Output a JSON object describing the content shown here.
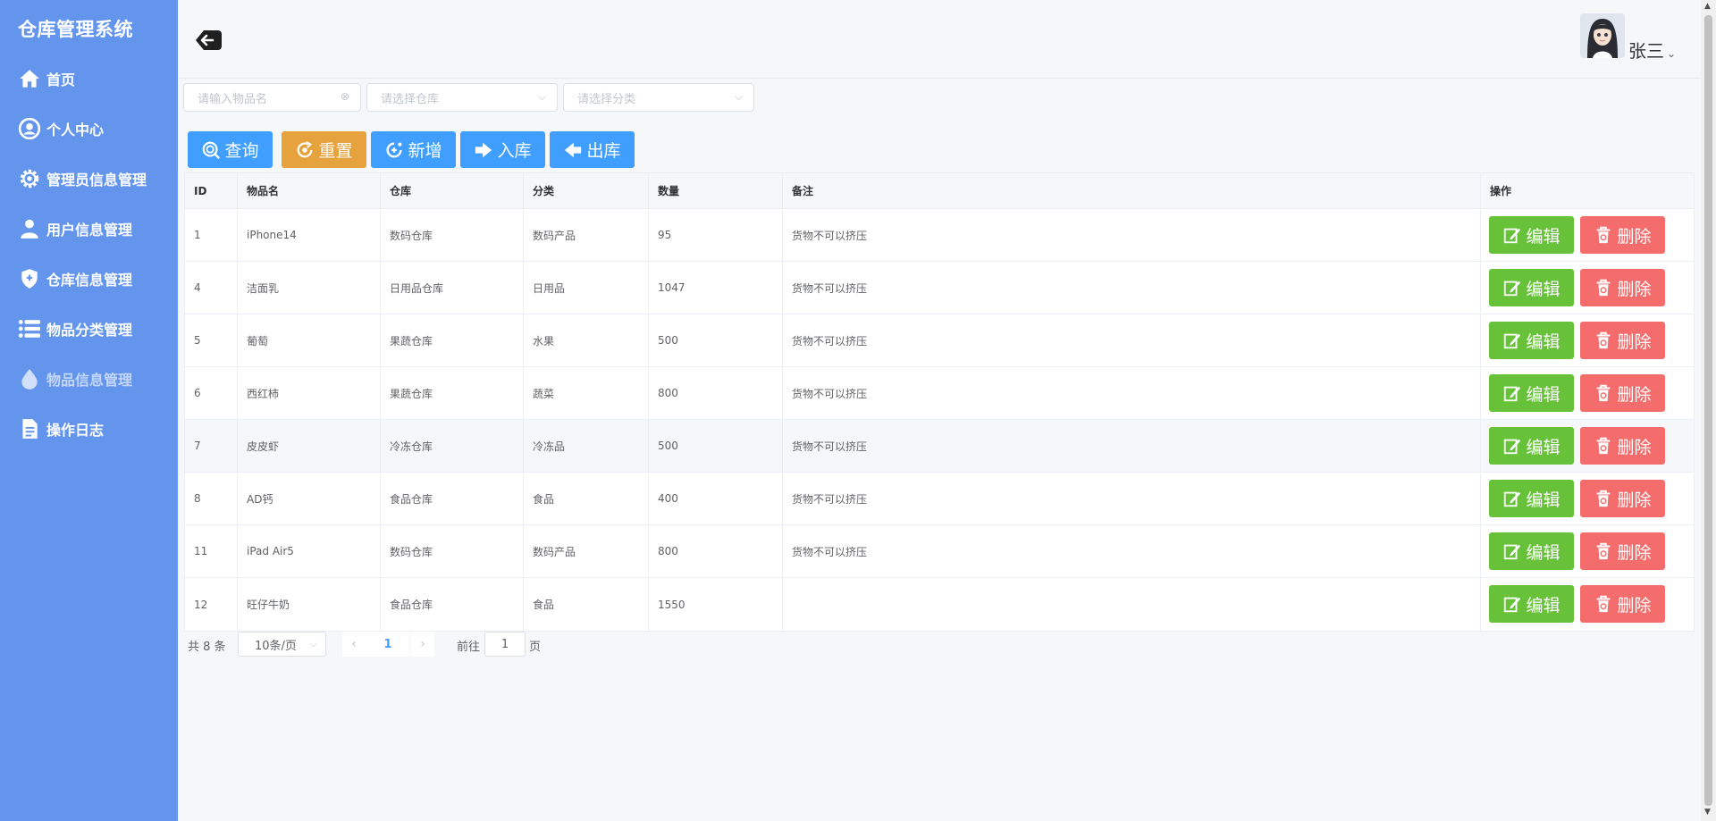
{
  "app": {
    "title": "仓库管理系统"
  },
  "sidebar": {
    "items": [
      {
        "label": "首页",
        "icon": "home-icon"
      },
      {
        "label": "个人中心",
        "icon": "user-circle-icon"
      },
      {
        "label": "管理员信息管理",
        "icon": "gear-icon"
      },
      {
        "label": "用户信息管理",
        "icon": "person-icon"
      },
      {
        "label": "仓库信息管理",
        "icon": "shield-icon"
      },
      {
        "label": "物品分类管理",
        "icon": "list-icon"
      },
      {
        "label": "物品信息管理",
        "icon": "drop-icon",
        "active": true
      },
      {
        "label": "操作日志",
        "icon": "document-icon"
      }
    ]
  },
  "header": {
    "username": "张三",
    "back_icon": "back-arrow-icon"
  },
  "filters": {
    "name_placeholder": "请输入物品名",
    "warehouse_placeholder": "请选择仓库",
    "category_placeholder": "请选择分类"
  },
  "toolbar": {
    "query": "查询",
    "reset": "重置",
    "add": "新增",
    "stock_in": "入库",
    "stock_out": "出库"
  },
  "table": {
    "columns": [
      "ID",
      "物品名",
      "仓库",
      "分类",
      "数量",
      "备注",
      "操作"
    ],
    "edit_label": "编辑",
    "delete_label": "删除",
    "rows": [
      {
        "id": "1",
        "name": "iPhone14",
        "warehouse": "数码仓库",
        "category": "数码产品",
        "qty": "95",
        "note": "货物不可以挤压"
      },
      {
        "id": "4",
        "name": "洁面乳",
        "warehouse": "日用品仓库",
        "category": "日用品",
        "qty": "1047",
        "note": "货物不可以挤压"
      },
      {
        "id": "5",
        "name": "葡萄",
        "warehouse": "果蔬仓库",
        "category": "水果",
        "qty": "500",
        "note": "货物不可以挤压"
      },
      {
        "id": "6",
        "name": "西红柿",
        "warehouse": "果蔬仓库",
        "category": "蔬菜",
        "qty": "800",
        "note": "货物不可以挤压"
      },
      {
        "id": "7",
        "name": "皮皮虾",
        "warehouse": "冷冻仓库",
        "category": "冷冻品",
        "qty": "500",
        "note": "货物不可以挤压"
      },
      {
        "id": "8",
        "name": "AD钙",
        "warehouse": "食品仓库",
        "category": "食品",
        "qty": "400",
        "note": "货物不可以挤压"
      },
      {
        "id": "11",
        "name": "iPad Air5",
        "warehouse": "数码仓库",
        "category": "数码产品",
        "qty": "800",
        "note": "货物不可以挤压"
      },
      {
        "id": "12",
        "name": "旺仔牛奶",
        "warehouse": "食品仓库",
        "category": "食品",
        "qty": "1550",
        "note": ""
      }
    ]
  },
  "pagination": {
    "total_text": "共 8 条",
    "page_size": "10条/页",
    "current_page": "1",
    "goto_label": "前往",
    "goto_value": "1",
    "page_suffix": "页"
  },
  "colors": {
    "sidebar": "#6495ed",
    "primary": "#409eff",
    "warning": "#e6a23c",
    "success": "#67c23a",
    "danger": "#f56c6c"
  }
}
